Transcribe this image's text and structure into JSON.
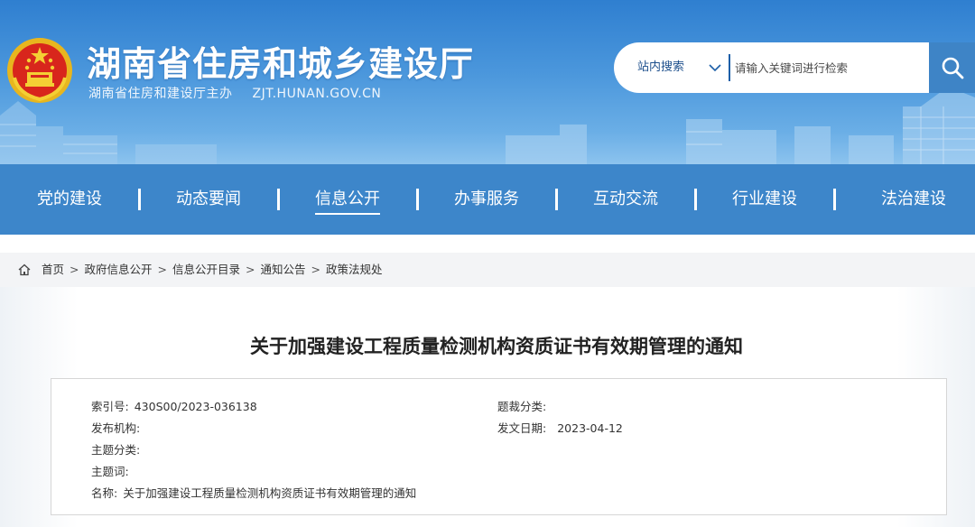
{
  "header": {
    "site_title": "湖南省住房和城乡建设厅",
    "site_subtitle": "湖南省住房和建设厅主办",
    "site_domain": "ZJT.HUNAN.GOV.CN",
    "emblem_icon": "national-emblem-icon",
    "accent_color": "#3d86ca"
  },
  "search": {
    "scope_label": "站内搜索",
    "placeholder": "请输入关键词进行检索",
    "button_icon": "search-icon"
  },
  "nav": {
    "items": [
      {
        "label": "党的建设"
      },
      {
        "label": "动态要闻"
      },
      {
        "label": "信息公开",
        "active": true
      },
      {
        "label": "办事服务"
      },
      {
        "label": "互动交流"
      },
      {
        "label": "行业建设"
      },
      {
        "label": "法治建设"
      }
    ]
  },
  "breadcrumb": {
    "items": [
      "首页",
      "政府信息公开",
      "信息公开目录",
      "通知公告",
      "政策法规处"
    ],
    "separator": ">"
  },
  "article": {
    "title": "关于加强建设工程质量检测机构资质证书有效期管理的通知",
    "meta": {
      "index_label": "索引号:",
      "index_value": "430S00/2023-036138",
      "category_label": "题裁分类:",
      "category_value": "",
      "publisher_label": "发布机构:",
      "publisher_value": "",
      "date_label": "发文日期:",
      "date_value": "2023-04-12",
      "subject_label": "主题分类:",
      "subject_value": "",
      "keywords_label": "主题词:",
      "keywords_value": "",
      "name_label": "名称:",
      "name_value": "关于加强建设工程质量检测机构资质证书有效期管理的通知"
    }
  }
}
